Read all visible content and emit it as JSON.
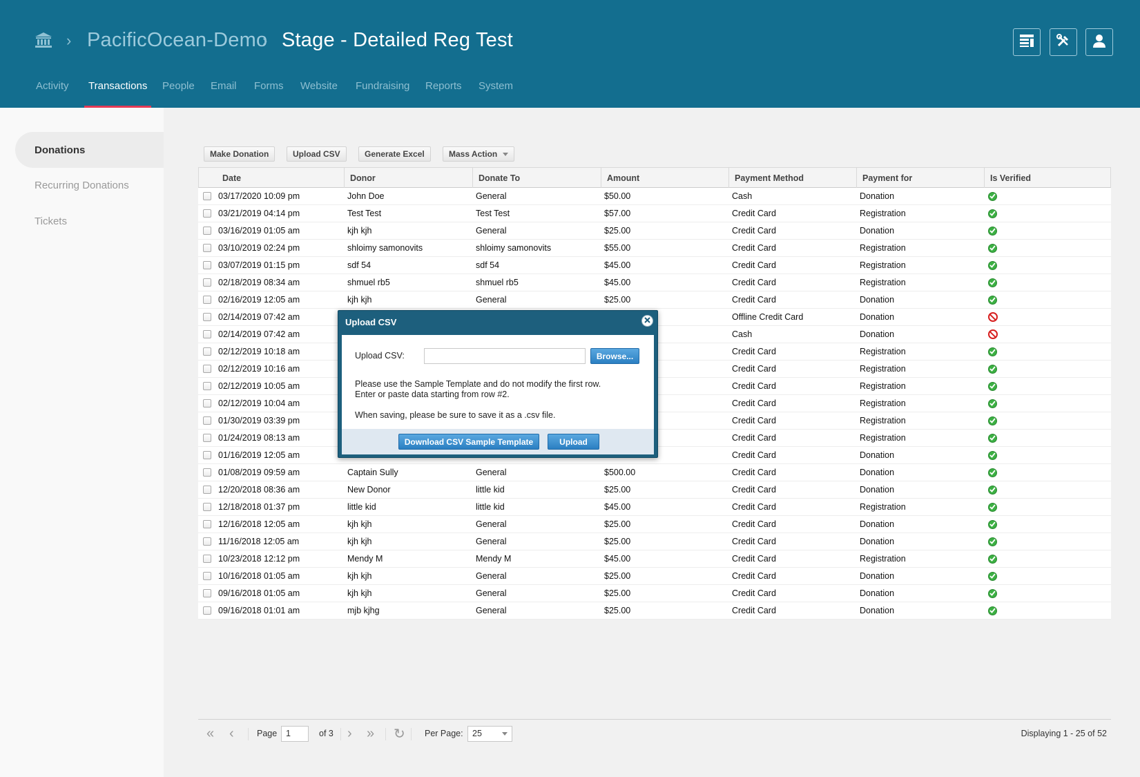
{
  "header": {
    "breadcrumb": [
      "PacificOcean-Demo",
      "Stage - Detailed Reg Test"
    ],
    "icons": [
      "layout-icon",
      "tools-icon",
      "user-icon"
    ],
    "nav": [
      "Activity",
      "Transactions",
      "People",
      "Email",
      "Forms",
      "Website",
      "Fundraising",
      "Reports",
      "System"
    ],
    "nav_active": "Transactions"
  },
  "sidebar": {
    "items": [
      "Donations",
      "Recurring Donations",
      "Tickets"
    ],
    "active": "Donations"
  },
  "toolbar": {
    "make_donation": "Make Donation",
    "upload_csv": "Upload CSV",
    "generate_excel": "Generate Excel",
    "mass_action": "Mass Action"
  },
  "grid": {
    "columns": [
      "Date",
      "Donor",
      "Donate To",
      "Amount",
      "Payment Method",
      "Payment for",
      "Is Verified"
    ],
    "rows": [
      {
        "date": "03/17/2020 10:09 pm",
        "donor": "John Doe",
        "donate_to": "General",
        "amount": "$50.00",
        "method": "Cash",
        "payment_for": "Donation",
        "verified": true
      },
      {
        "date": "03/21/2019 04:14 pm",
        "donor": "Test Test",
        "donate_to": "Test Test",
        "amount": "$57.00",
        "method": "Credit Card",
        "payment_for": "Registration",
        "verified": true
      },
      {
        "date": "03/16/2019 01:05 am",
        "donor": "kjh kjh",
        "donate_to": "General",
        "amount": "$25.00",
        "method": "Credit Card",
        "payment_for": "Donation",
        "verified": true
      },
      {
        "date": "03/10/2019 02:24 pm",
        "donor": "shloimy samonovits",
        "donate_to": "shloimy samonovits",
        "amount": "$55.00",
        "method": "Credit Card",
        "payment_for": "Registration",
        "verified": true
      },
      {
        "date": "03/07/2019 01:15 pm",
        "donor": "sdf 54",
        "donate_to": "sdf 54",
        "amount": "$45.00",
        "method": "Credit Card",
        "payment_for": "Registration",
        "verified": true
      },
      {
        "date": "02/18/2019 08:34 am",
        "donor": "shmuel rb5",
        "donate_to": "shmuel rb5",
        "amount": "$45.00",
        "method": "Credit Card",
        "payment_for": "Registration",
        "verified": true
      },
      {
        "date": "02/16/2019 12:05 am",
        "donor": "kjh kjh",
        "donate_to": "General",
        "amount": "$25.00",
        "method": "Credit Card",
        "payment_for": "Donation",
        "verified": true
      },
      {
        "date": "02/14/2019 07:42 am",
        "donor": "",
        "donate_to": "",
        "amount": "",
        "method": "Offline Credit Card",
        "payment_for": "Donation",
        "verified": false
      },
      {
        "date": "02/14/2019 07:42 am",
        "donor": "",
        "donate_to": "",
        "amount": "",
        "method": "Cash",
        "payment_for": "Donation",
        "verified": false
      },
      {
        "date": "02/12/2019 10:18 am",
        "donor": "",
        "donate_to": "",
        "amount": "",
        "method": "Credit Card",
        "payment_for": "Registration",
        "verified": true
      },
      {
        "date": "02/12/2019 10:16 am",
        "donor": "",
        "donate_to": "",
        "amount": "",
        "method": "Credit Card",
        "payment_for": "Registration",
        "verified": true
      },
      {
        "date": "02/12/2019 10:05 am",
        "donor": "",
        "donate_to": "",
        "amount": "",
        "method": "Credit Card",
        "payment_for": "Registration",
        "verified": true
      },
      {
        "date": "02/12/2019 10:04 am",
        "donor": "",
        "donate_to": "",
        "amount": "",
        "method": "Credit Card",
        "payment_for": "Registration",
        "verified": true
      },
      {
        "date": "01/30/2019 03:39 pm",
        "donor": "",
        "donate_to": "",
        "amount": "",
        "method": "Credit Card",
        "payment_for": "Registration",
        "verified": true
      },
      {
        "date": "01/24/2019 08:13 am",
        "donor": "",
        "donate_to": "",
        "amount": "",
        "method": "Credit Card",
        "payment_for": "Registration",
        "verified": true
      },
      {
        "date": "01/16/2019 12:05 am",
        "donor": "",
        "donate_to": "",
        "amount": "",
        "method": "Credit Card",
        "payment_for": "Donation",
        "verified": true
      },
      {
        "date": "01/08/2019 09:59 am",
        "donor": "Captain Sully",
        "donate_to": "General",
        "amount": "$500.00",
        "method": "Credit Card",
        "payment_for": "Donation",
        "verified": true
      },
      {
        "date": "12/20/2018 08:36 am",
        "donor": "New Donor",
        "donate_to": "little kid",
        "amount": "$25.00",
        "method": "Credit Card",
        "payment_for": "Donation",
        "verified": true
      },
      {
        "date": "12/18/2018 01:37 pm",
        "donor": "little kid",
        "donate_to": "little kid",
        "amount": "$45.00",
        "method": "Credit Card",
        "payment_for": "Registration",
        "verified": true
      },
      {
        "date": "12/16/2018 12:05 am",
        "donor": "kjh kjh",
        "donate_to": "General",
        "amount": "$25.00",
        "method": "Credit Card",
        "payment_for": "Donation",
        "verified": true
      },
      {
        "date": "11/16/2018 12:05 am",
        "donor": "kjh kjh",
        "donate_to": "General",
        "amount": "$25.00",
        "method": "Credit Card",
        "payment_for": "Donation",
        "verified": true
      },
      {
        "date": "10/23/2018 12:12 pm",
        "donor": "Mendy M",
        "donate_to": "Mendy M",
        "amount": "$45.00",
        "method": "Credit Card",
        "payment_for": "Registration",
        "verified": true
      },
      {
        "date": "10/16/2018 01:05 am",
        "donor": "kjh kjh",
        "donate_to": "General",
        "amount": "$25.00",
        "method": "Credit Card",
        "payment_for": "Donation",
        "verified": true
      },
      {
        "date": "09/16/2018 01:05 am",
        "donor": "kjh kjh",
        "donate_to": "General",
        "amount": "$25.00",
        "method": "Credit Card",
        "payment_for": "Donation",
        "verified": true
      },
      {
        "date": "09/16/2018 01:01 am",
        "donor": "mjb kjhg",
        "donate_to": "General",
        "amount": "$25.00",
        "method": "Credit Card",
        "payment_for": "Donation",
        "verified": true
      }
    ]
  },
  "pager": {
    "page_label": "Page",
    "page_value": "1",
    "of_label": "of 3",
    "per_page_label": "Per Page:",
    "per_page_value": "25",
    "display_text": "Displaying 1 - 25 of 52"
  },
  "modal": {
    "title": "Upload CSV",
    "field_label": "Upload CSV:",
    "input_value": "",
    "browse_label": "Browse...",
    "line1": "Please use the Sample Template and do not modify the first row.",
    "line2": "Enter or paste data starting from row #2.",
    "line3": "When saving, please be sure to save it as a .csv file.",
    "download_label": "Download CSV Sample Template",
    "upload_label": "Upload"
  },
  "colors": {
    "header_bg": "#136e8f",
    "nav_active_underline": "#e53a55",
    "verified_ok": "#3cb043",
    "verified_no": "#d71f1f",
    "modal_frame": "#1d5f7d",
    "primary_button": "#2b7fc2"
  }
}
